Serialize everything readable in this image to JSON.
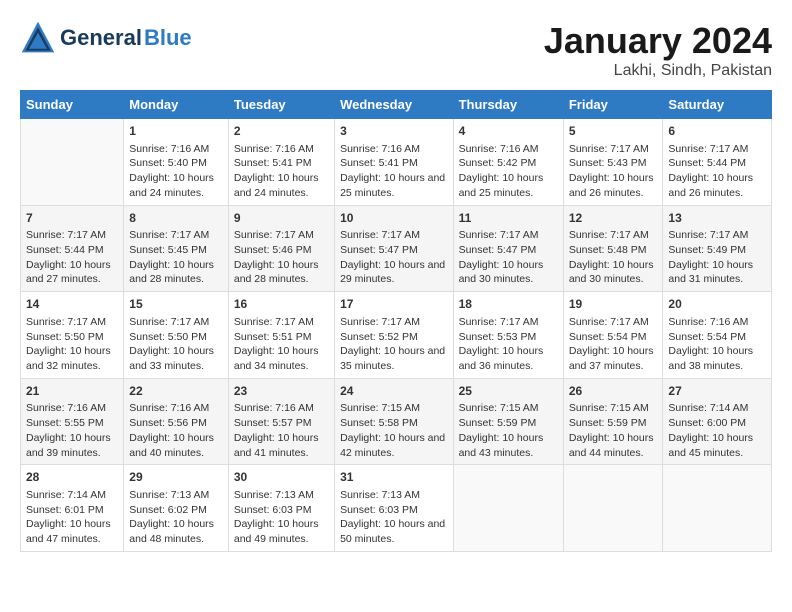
{
  "header": {
    "logo_line1": "General",
    "logo_line2": "Blue",
    "title": "January 2024",
    "subtitle": "Lakhi, Sindh, Pakistan"
  },
  "columns": [
    "Sunday",
    "Monday",
    "Tuesday",
    "Wednesday",
    "Thursday",
    "Friday",
    "Saturday"
  ],
  "rows": [
    [
      {
        "num": "",
        "sunrise": "",
        "sunset": "",
        "daylight": ""
      },
      {
        "num": "1",
        "sunrise": "Sunrise: 7:16 AM",
        "sunset": "Sunset: 5:40 PM",
        "daylight": "Daylight: 10 hours and 24 minutes."
      },
      {
        "num": "2",
        "sunrise": "Sunrise: 7:16 AM",
        "sunset": "Sunset: 5:41 PM",
        "daylight": "Daylight: 10 hours and 24 minutes."
      },
      {
        "num": "3",
        "sunrise": "Sunrise: 7:16 AM",
        "sunset": "Sunset: 5:41 PM",
        "daylight": "Daylight: 10 hours and 25 minutes."
      },
      {
        "num": "4",
        "sunrise": "Sunrise: 7:16 AM",
        "sunset": "Sunset: 5:42 PM",
        "daylight": "Daylight: 10 hours and 25 minutes."
      },
      {
        "num": "5",
        "sunrise": "Sunrise: 7:17 AM",
        "sunset": "Sunset: 5:43 PM",
        "daylight": "Daylight: 10 hours and 26 minutes."
      },
      {
        "num": "6",
        "sunrise": "Sunrise: 7:17 AM",
        "sunset": "Sunset: 5:44 PM",
        "daylight": "Daylight: 10 hours and 26 minutes."
      }
    ],
    [
      {
        "num": "7",
        "sunrise": "Sunrise: 7:17 AM",
        "sunset": "Sunset: 5:44 PM",
        "daylight": "Daylight: 10 hours and 27 minutes."
      },
      {
        "num": "8",
        "sunrise": "Sunrise: 7:17 AM",
        "sunset": "Sunset: 5:45 PM",
        "daylight": "Daylight: 10 hours and 28 minutes."
      },
      {
        "num": "9",
        "sunrise": "Sunrise: 7:17 AM",
        "sunset": "Sunset: 5:46 PM",
        "daylight": "Daylight: 10 hours and 28 minutes."
      },
      {
        "num": "10",
        "sunrise": "Sunrise: 7:17 AM",
        "sunset": "Sunset: 5:47 PM",
        "daylight": "Daylight: 10 hours and 29 minutes."
      },
      {
        "num": "11",
        "sunrise": "Sunrise: 7:17 AM",
        "sunset": "Sunset: 5:47 PM",
        "daylight": "Daylight: 10 hours and 30 minutes."
      },
      {
        "num": "12",
        "sunrise": "Sunrise: 7:17 AM",
        "sunset": "Sunset: 5:48 PM",
        "daylight": "Daylight: 10 hours and 30 minutes."
      },
      {
        "num": "13",
        "sunrise": "Sunrise: 7:17 AM",
        "sunset": "Sunset: 5:49 PM",
        "daylight": "Daylight: 10 hours and 31 minutes."
      }
    ],
    [
      {
        "num": "14",
        "sunrise": "Sunrise: 7:17 AM",
        "sunset": "Sunset: 5:50 PM",
        "daylight": "Daylight: 10 hours and 32 minutes."
      },
      {
        "num": "15",
        "sunrise": "Sunrise: 7:17 AM",
        "sunset": "Sunset: 5:50 PM",
        "daylight": "Daylight: 10 hours and 33 minutes."
      },
      {
        "num": "16",
        "sunrise": "Sunrise: 7:17 AM",
        "sunset": "Sunset: 5:51 PM",
        "daylight": "Daylight: 10 hours and 34 minutes."
      },
      {
        "num": "17",
        "sunrise": "Sunrise: 7:17 AM",
        "sunset": "Sunset: 5:52 PM",
        "daylight": "Daylight: 10 hours and 35 minutes."
      },
      {
        "num": "18",
        "sunrise": "Sunrise: 7:17 AM",
        "sunset": "Sunset: 5:53 PM",
        "daylight": "Daylight: 10 hours and 36 minutes."
      },
      {
        "num": "19",
        "sunrise": "Sunrise: 7:17 AM",
        "sunset": "Sunset: 5:54 PM",
        "daylight": "Daylight: 10 hours and 37 minutes."
      },
      {
        "num": "20",
        "sunrise": "Sunrise: 7:16 AM",
        "sunset": "Sunset: 5:54 PM",
        "daylight": "Daylight: 10 hours and 38 minutes."
      }
    ],
    [
      {
        "num": "21",
        "sunrise": "Sunrise: 7:16 AM",
        "sunset": "Sunset: 5:55 PM",
        "daylight": "Daylight: 10 hours and 39 minutes."
      },
      {
        "num": "22",
        "sunrise": "Sunrise: 7:16 AM",
        "sunset": "Sunset: 5:56 PM",
        "daylight": "Daylight: 10 hours and 40 minutes."
      },
      {
        "num": "23",
        "sunrise": "Sunrise: 7:16 AM",
        "sunset": "Sunset: 5:57 PM",
        "daylight": "Daylight: 10 hours and 41 minutes."
      },
      {
        "num": "24",
        "sunrise": "Sunrise: 7:15 AM",
        "sunset": "Sunset: 5:58 PM",
        "daylight": "Daylight: 10 hours and 42 minutes."
      },
      {
        "num": "25",
        "sunrise": "Sunrise: 7:15 AM",
        "sunset": "Sunset: 5:59 PM",
        "daylight": "Daylight: 10 hours and 43 minutes."
      },
      {
        "num": "26",
        "sunrise": "Sunrise: 7:15 AM",
        "sunset": "Sunset: 5:59 PM",
        "daylight": "Daylight: 10 hours and 44 minutes."
      },
      {
        "num": "27",
        "sunrise": "Sunrise: 7:14 AM",
        "sunset": "Sunset: 6:00 PM",
        "daylight": "Daylight: 10 hours and 45 minutes."
      }
    ],
    [
      {
        "num": "28",
        "sunrise": "Sunrise: 7:14 AM",
        "sunset": "Sunset: 6:01 PM",
        "daylight": "Daylight: 10 hours and 47 minutes."
      },
      {
        "num": "29",
        "sunrise": "Sunrise: 7:13 AM",
        "sunset": "Sunset: 6:02 PM",
        "daylight": "Daylight: 10 hours and 48 minutes."
      },
      {
        "num": "30",
        "sunrise": "Sunrise: 7:13 AM",
        "sunset": "Sunset: 6:03 PM",
        "daylight": "Daylight: 10 hours and 49 minutes."
      },
      {
        "num": "31",
        "sunrise": "Sunrise: 7:13 AM",
        "sunset": "Sunset: 6:03 PM",
        "daylight": "Daylight: 10 hours and 50 minutes."
      },
      {
        "num": "",
        "sunrise": "",
        "sunset": "",
        "daylight": ""
      },
      {
        "num": "",
        "sunrise": "",
        "sunset": "",
        "daylight": ""
      },
      {
        "num": "",
        "sunrise": "",
        "sunset": "",
        "daylight": ""
      }
    ]
  ]
}
